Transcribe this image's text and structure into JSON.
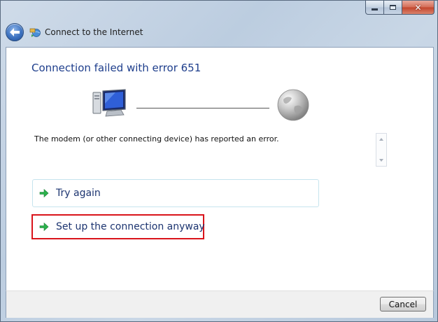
{
  "window": {
    "title": "Connect to the Internet",
    "caption": {
      "minimize_icon": "minimize-icon",
      "maximize_icon": "maximize-icon",
      "close_icon": "close-icon"
    },
    "back_icon": "back-arrow-icon",
    "app_icon": "network-connection-icon"
  },
  "main": {
    "heading": "Connection failed with error 651",
    "illustration": {
      "left_icon": "computer-icon",
      "right_icon": "internet-globe-icon"
    },
    "message": "The modem (or other connecting device) has reported an error.",
    "options": [
      {
        "label": "Try again",
        "icon": "green-arrow-icon"
      },
      {
        "label": "Set up the connection anyway",
        "icon": "green-arrow-icon"
      }
    ]
  },
  "footer": {
    "cancel_label": "Cancel"
  },
  "colors": {
    "heading": "#1e3e8c",
    "link_text": "#1c3470",
    "highlight_border": "#d9141b",
    "option_border": "#c6e4ee",
    "arrow_green": "#2bb24c"
  }
}
